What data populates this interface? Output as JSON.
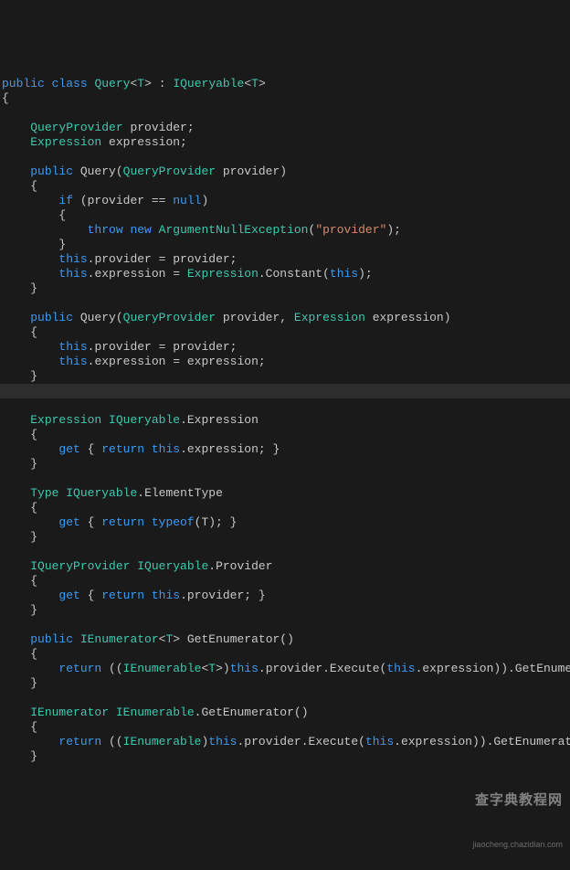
{
  "code": {
    "line1_kw1": "public",
    "line1_kw2": "class",
    "line1_type1": "Query",
    "line1_punc1": "<",
    "line1_type2": "T",
    "line1_punc2": "> : ",
    "line1_type3": "IQueryable",
    "line1_punc3": "<",
    "line1_type4": "T",
    "line1_punc4": ">",
    "line2": "{",
    "line4_type": "QueryProvider",
    "line4_ident": " provider;",
    "line5_type": "Expression",
    "line5_ident": " expression;",
    "line7_kw": "public",
    "line7_ident1": " Query(",
    "line7_type": "QueryProvider",
    "line7_ident2": " provider)",
    "line8": "    {",
    "line9_kw1": "if",
    "line9_punc1": " (provider == ",
    "line9_kw2": "null",
    "line9_punc2": ")",
    "line10": "        {",
    "line11_kw1": "throw",
    "line11_kw2": " new",
    "line11_type": " ArgumentNullException",
    "line11_punc1": "(",
    "line11_str": "\"provider\"",
    "line11_punc2": ");",
    "line12": "        }",
    "line13_kw": "this",
    "line13_ident": ".provider = provider;",
    "line14_kw1": "this",
    "line14_punc1": ".expression = ",
    "line14_type": "Expression",
    "line14_punc2": ".Constant(",
    "line14_kw2": "this",
    "line14_punc3": ");",
    "line15": "    }",
    "line17_kw": "public",
    "line17_ident1": " Query(",
    "line17_type1": "QueryProvider",
    "line17_ident2": " provider, ",
    "line17_type2": "Expression",
    "line17_ident3": " expression)",
    "line18": "    {",
    "line19_kw": "this",
    "line19_ident": ".provider = provider;",
    "line20_kw": "this",
    "line20_ident": ".expression = expression;",
    "line21": "    }",
    "line23_type1": "Expression",
    "line23_type2": " IQueryable",
    "line23_ident": ".Expression",
    "line24": "    {",
    "line25_kw1": "get",
    "line25_punc1": " { ",
    "line25_kw2": "return",
    "line25_kw3": " this",
    "line25_punc2": ".expression; }",
    "line26": "    }",
    "line28_type1": "Type",
    "line28_type2": " IQueryable",
    "line28_ident": ".ElementType",
    "line29": "    {",
    "line30_kw1": "get",
    "line30_punc1": " { ",
    "line30_kw2": "return",
    "line30_kw3": " typeof",
    "line30_punc2": "(T); }",
    "line31": "    }",
    "line33_type1": "IQueryProvider",
    "line33_type2": " IQueryable",
    "line33_ident": ".Provider",
    "line34": "    {",
    "line35_kw1": "get",
    "line35_punc1": " { ",
    "line35_kw2": "return",
    "line35_kw3": " this",
    "line35_punc2": ".provider; }",
    "line36": "    }",
    "line38_kw": "public",
    "line38_type1": " IEnumerator",
    "line38_punc1": "<",
    "line38_type2": "T",
    "line38_punc2": "> GetEnumerator()",
    "line39": "    {",
    "line40_kw1": "return",
    "line40_punc1": " ((",
    "line40_type1": "IEnumerable",
    "line40_punc2": "<",
    "line40_type2": "T",
    "line40_punc3": ">)",
    "line40_kw2": "this",
    "line40_punc4": ".provider.Execute(",
    "line40_kw3": "this",
    "line40_punc5": ".expression)).GetEnumerator();",
    "line41": "    }",
    "line43_type1": "IEnumerator",
    "line43_type2": " IEnumerable",
    "line43_ident": ".GetEnumerator()",
    "line44": "    {",
    "line45_kw1": "return",
    "line45_punc1": " ((",
    "line45_type": "IEnumerable",
    "line45_punc2": ")",
    "line45_kw2": "this",
    "line45_punc3": ".provider.Execute(",
    "line45_kw3": "this",
    "line45_punc4": ".expression)).GetEnumerator();",
    "line46": "    }"
  },
  "watermark": {
    "title": "查字典教程网",
    "url": "jiaocheng.chazidian.com"
  }
}
